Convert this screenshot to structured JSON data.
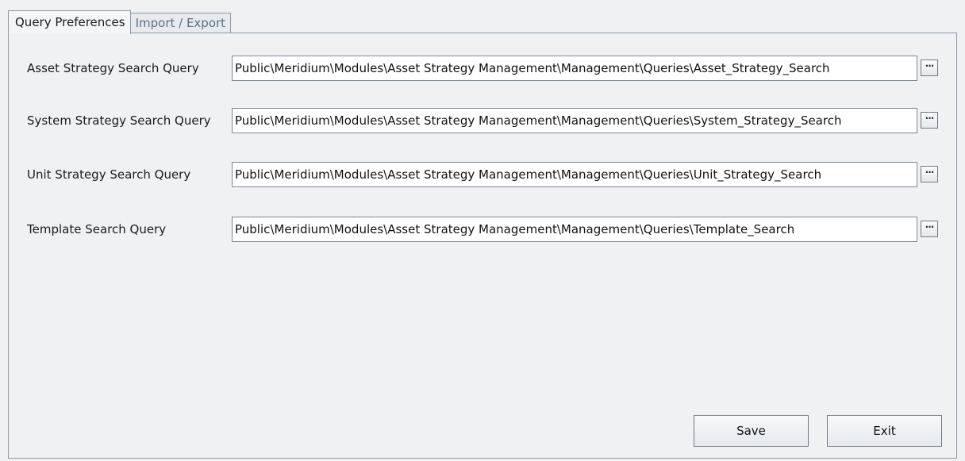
{
  "tabs": [
    {
      "label": "Query Preferences",
      "active": true
    },
    {
      "label": "Import / Export",
      "active": false
    }
  ],
  "rows": [
    {
      "label": "Asset Strategy Search Query",
      "value": "Public\\Meridium\\Modules\\Asset Strategy Management\\Management\\Queries\\Asset_Strategy_Search",
      "browse_label": "···"
    },
    {
      "label": "System Strategy Search Query",
      "value": "Public\\Meridium\\Modules\\Asset Strategy Management\\Management\\Queries\\System_Strategy_Search",
      "browse_label": "···"
    },
    {
      "label": "Unit Strategy Search Query",
      "value": "Public\\Meridium\\Modules\\Asset Strategy Management\\Management\\Queries\\Unit_Strategy_Search",
      "browse_label": "···"
    },
    {
      "label": "Template Search Query",
      "value": "Public\\Meridium\\Modules\\Asset Strategy Management\\Management\\Queries\\Template_Search",
      "browse_label": "···"
    }
  ],
  "buttons": {
    "save": "Save",
    "exit": "Exit"
  },
  "colors": {
    "border": "#8a9aad",
    "inactive_tab_text": "#5a6e86"
  }
}
